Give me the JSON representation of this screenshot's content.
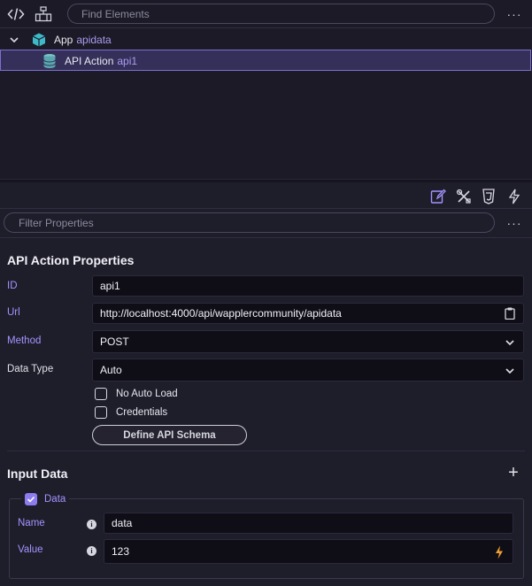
{
  "toolbar": {
    "code_icon": "code-icon",
    "structure_icon": "structure-icon",
    "search_placeholder": "Find Elements",
    "more_label": "···"
  },
  "tree": {
    "app": {
      "name": "App",
      "id": "apidata",
      "icon": "cube-icon"
    },
    "action": {
      "name": "API Action",
      "id": "api1",
      "icon": "database-icon"
    }
  },
  "properties_toolbar": {
    "icons": [
      "edit-icon",
      "tools-icon",
      "css-icon",
      "dynamic-events-icon"
    ],
    "filter_placeholder": "Filter Properties",
    "more_label": "···"
  },
  "properties": {
    "title": "API Action Properties",
    "id": {
      "label": "ID",
      "value": "api1"
    },
    "url": {
      "label": "Url",
      "value": "http://localhost:4000/api/wapplercommunity/apidata"
    },
    "method": {
      "label": "Method",
      "value": "POST"
    },
    "data_type": {
      "label": "Data Type",
      "value": "Auto"
    },
    "no_auto_load": {
      "label": "No Auto Load",
      "checked": false
    },
    "credentials": {
      "label": "Credentials",
      "checked": false
    },
    "schema_button": "Define API Schema"
  },
  "input_data": {
    "title": "Input Data",
    "add_label": "+",
    "group": {
      "label": "Data",
      "checked": true,
      "name": {
        "label": "Name",
        "value": "data"
      },
      "value": {
        "label": "Value",
        "value": "123"
      }
    }
  },
  "colors": {
    "accent": "#a494ff",
    "selection_bg": "#35305a",
    "app_icon": "#3fb8c8",
    "lightning": "#f0a030"
  }
}
